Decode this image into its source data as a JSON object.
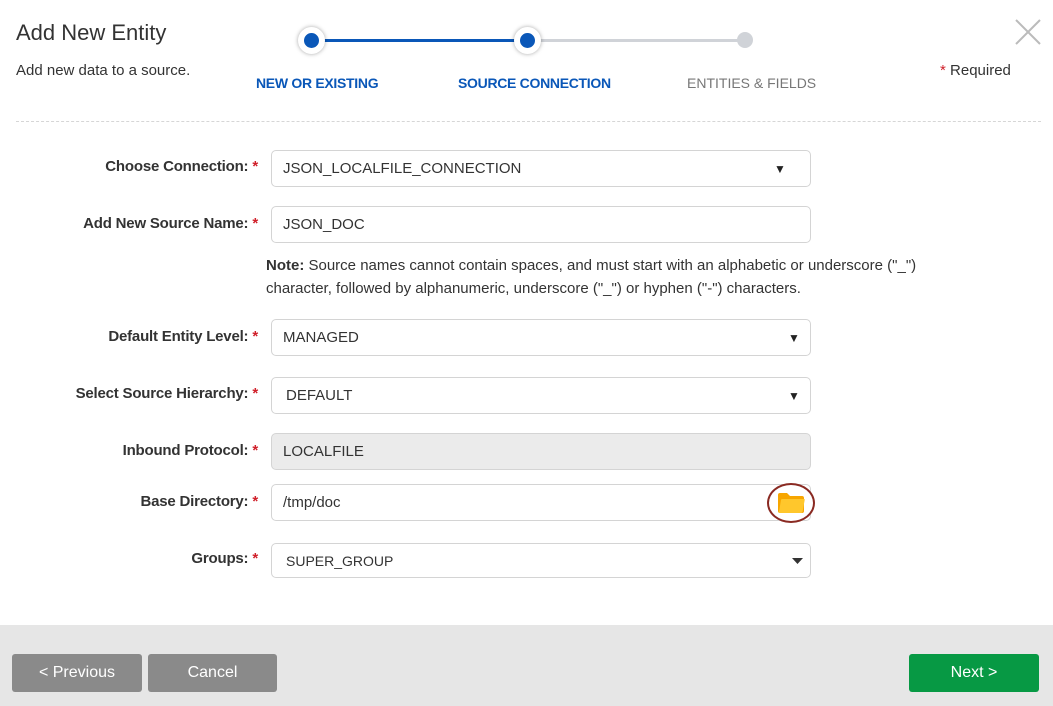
{
  "header": {
    "title": "Add New Entity",
    "subtitle": "Add new data to a source.",
    "required_marker": "*",
    "required_label": "Required"
  },
  "stepper": {
    "steps": [
      {
        "label": "NEW OR EXISTING",
        "state": "complete"
      },
      {
        "label": "SOURCE CONNECTION",
        "state": "current"
      },
      {
        "label": "ENTITIES & FIELDS",
        "state": "pending"
      }
    ],
    "active_color": "#0a57b8",
    "inactive_color": "#d0d3d8"
  },
  "form": {
    "required_marker": "*",
    "fields": {
      "connection": {
        "label": "Choose Connection:",
        "value": "JSON_LOCALFILE_CONNECTION",
        "type": "select"
      },
      "source_name": {
        "label": "Add New Source Name:",
        "value": "JSON_DOC",
        "type": "text"
      },
      "entity_level": {
        "label": "Default Entity Level:",
        "value": "MANAGED",
        "type": "select"
      },
      "source_hierarchy": {
        "label": "Select Source Hierarchy:",
        "value": "DEFAULT",
        "type": "select"
      },
      "inbound_protocol": {
        "label": "Inbound Protocol:",
        "value": "LOCALFILE",
        "type": "readonly"
      },
      "base_directory": {
        "label": "Base Directory:",
        "value": "/tmp/doc",
        "type": "text"
      },
      "groups": {
        "label": "Groups:",
        "value": "SUPER_GROUP",
        "type": "select"
      }
    },
    "note": {
      "prefix": "Note:",
      "text": " Source names cannot contain spaces, and must start with an alphabetic or underscore (\"_\") character, followed by alphanumeric, underscore (\"_\") or hyphen (\"-\") characters."
    },
    "icons": {
      "dropdown": "caret-down-icon",
      "browse": "folder-icon"
    }
  },
  "footer": {
    "previous_label": "< Previous",
    "cancel_label": "Cancel",
    "next_label": "Next >",
    "next_color": "#079944",
    "secondary_color": "#8a8a8a"
  }
}
